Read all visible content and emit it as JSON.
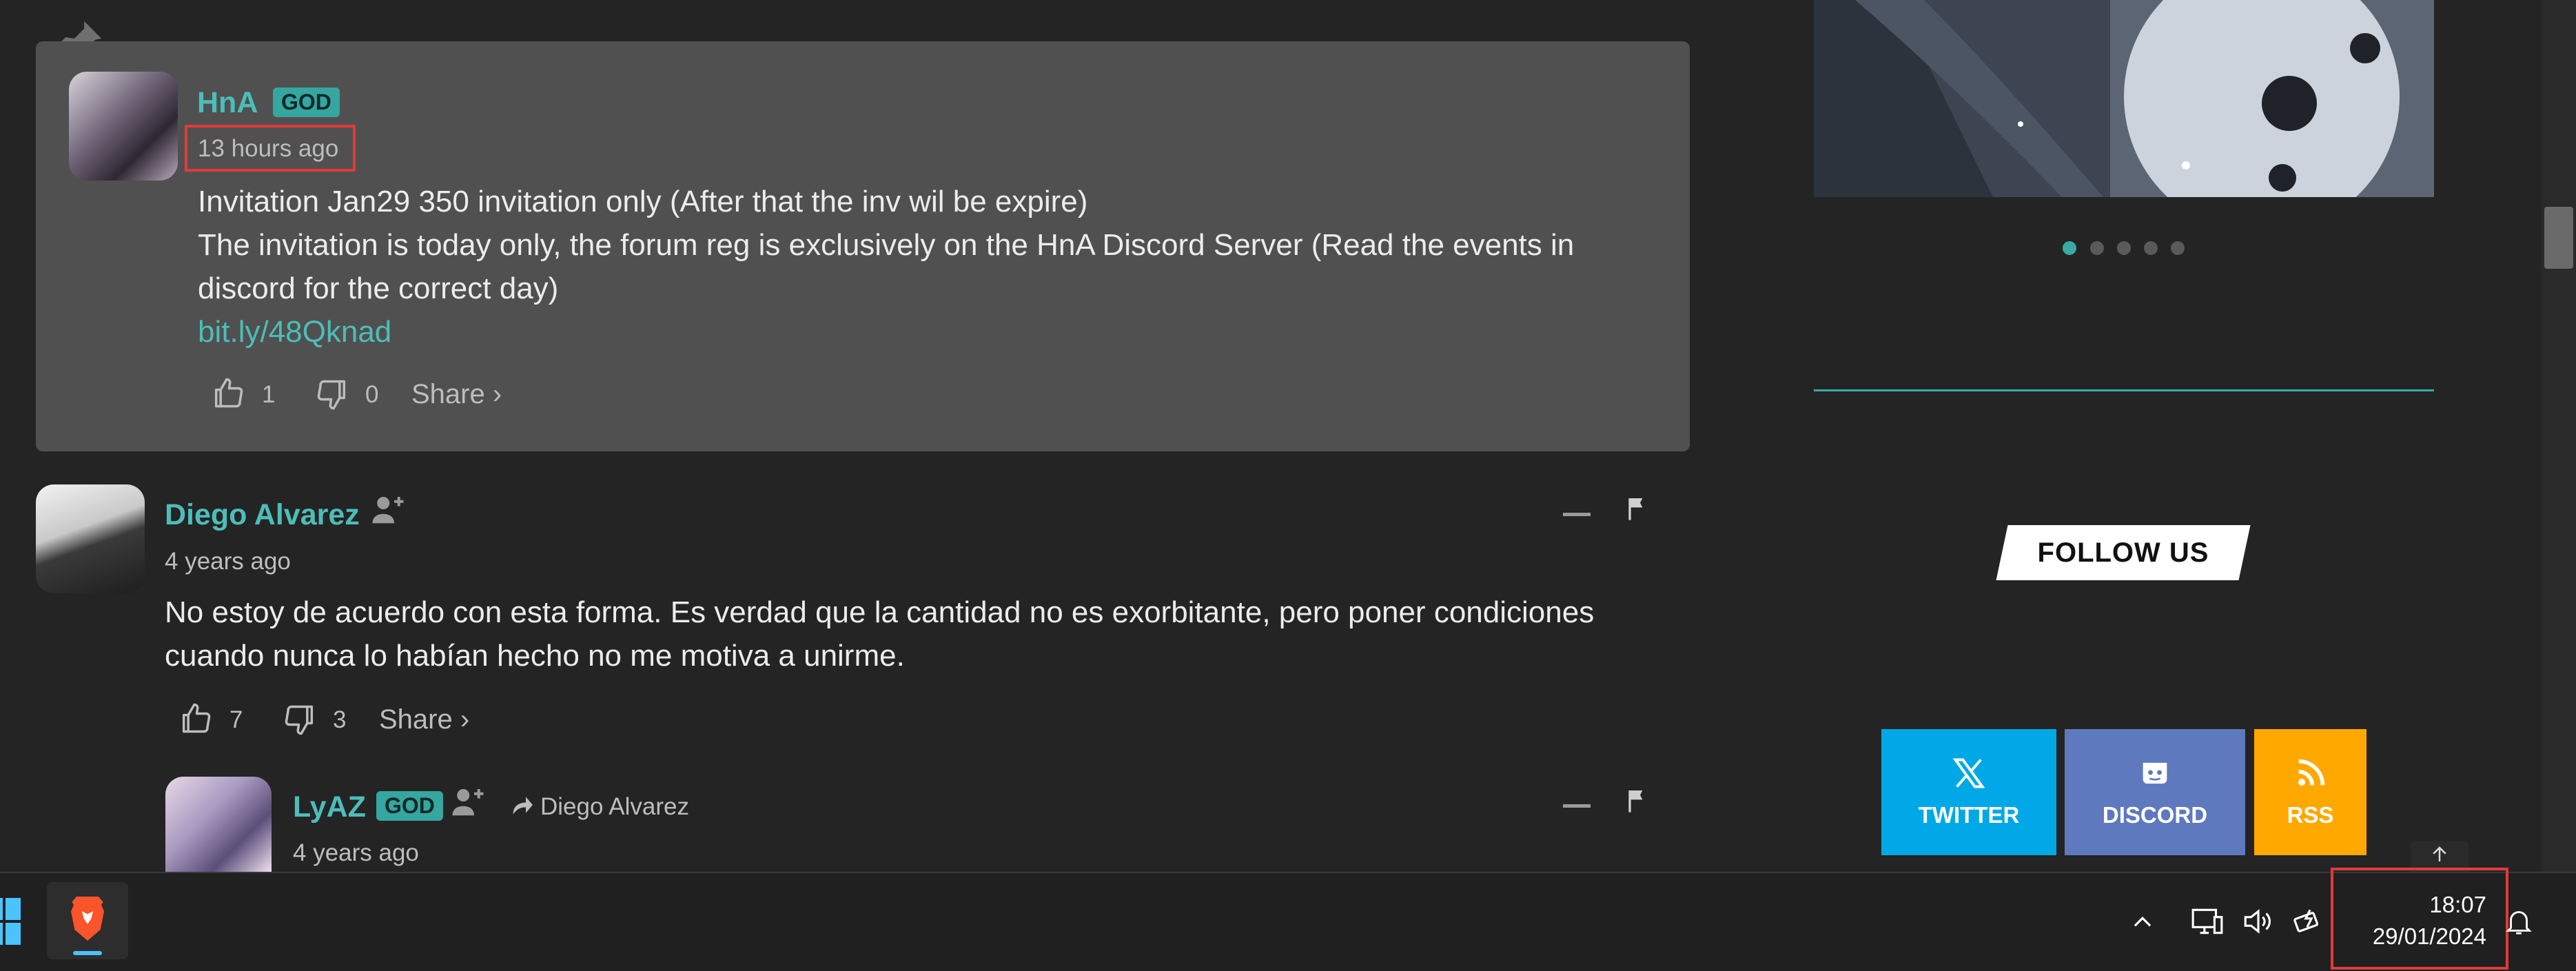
{
  "pinned": {
    "username": "HnA",
    "badge": "GOD",
    "timestamp": "13 hours ago",
    "lines": [
      "Invitation Jan29 350 invitation only (After that the inv wil be expire)",
      "The invitation is today only, the forum reg is exclusively on the HnA Discord Server (Read the events in",
      "discord for the correct day)"
    ],
    "link": "bit.ly/48Qknad",
    "likes": "1",
    "dislikes": "0",
    "share": "Share ›"
  },
  "comment1": {
    "username": "Diego Alvarez",
    "timestamp": "4 years ago",
    "lines": [
      "No estoy de acuerdo con esta forma. Es verdad que la cantidad no es exorbitante, pero poner condiciones",
      "cuando nunca lo habían hecho no me motiva a unirme."
    ],
    "likes": "7",
    "dislikes": "3",
    "share": "Share ›"
  },
  "reply1": {
    "username": "LyAZ",
    "badge": "GOD",
    "reply_to": "Diego Alvarez",
    "timestamp": "4 years ago"
  },
  "sidebar": {
    "follow_title": "FOLLOW US",
    "social": [
      {
        "label": "TWITTER",
        "color": "#00a8e8",
        "icon": "x-logo-icon"
      },
      {
        "label": "DISCORD",
        "color": "#5f79bf",
        "icon": "discord-icon"
      },
      {
        "label": "RSS",
        "color": "#ffa800",
        "icon": "rss-icon"
      }
    ]
  },
  "taskbar": {
    "time": "18:07",
    "date": "29/01/2024"
  },
  "colors": {
    "accent": "#4dbdb8",
    "highlight": "#e23a3a",
    "pinned_bg": "#505050",
    "page_bg": "#242424"
  }
}
